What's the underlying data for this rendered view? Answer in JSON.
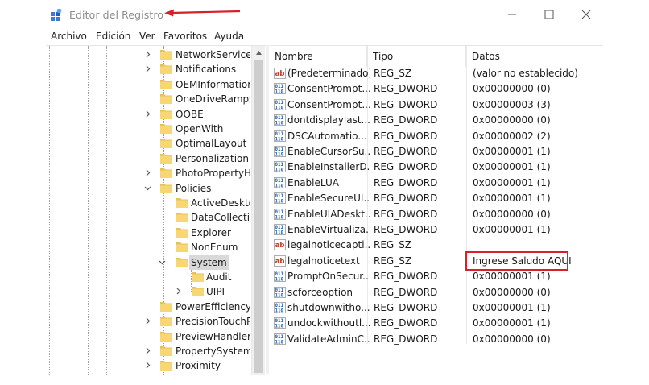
{
  "window": {
    "title": "Editor del Registro",
    "accent_color": "#d8202a"
  },
  "menu": [
    "Archivo",
    "Edición",
    "Ver",
    "Favoritos",
    "Ayuda"
  ],
  "tree": {
    "nodes": [
      {
        "label": "NetworkServiceTri",
        "level": 0,
        "expander": "collapsed"
      },
      {
        "label": "Notifications",
        "level": 0,
        "expander": "collapsed"
      },
      {
        "label": "OEMInformation",
        "level": 0,
        "expander": "none"
      },
      {
        "label": "OneDriveRamps",
        "level": 0,
        "expander": "none"
      },
      {
        "label": "OOBE",
        "level": 0,
        "expander": "collapsed"
      },
      {
        "label": "OpenWith",
        "level": 0,
        "expander": "none"
      },
      {
        "label": "OptimalLayout",
        "level": 0,
        "expander": "none"
      },
      {
        "label": "Personalization",
        "level": 0,
        "expander": "none"
      },
      {
        "label": "PhotoPropertyHa",
        "level": 0,
        "expander": "collapsed"
      },
      {
        "label": "Policies",
        "level": 0,
        "expander": "expanded"
      },
      {
        "label": "ActiveDesktop",
        "level": 1,
        "expander": "none"
      },
      {
        "label": "DataCollection",
        "level": 1,
        "expander": "none"
      },
      {
        "label": "Explorer",
        "level": 1,
        "expander": "none"
      },
      {
        "label": "NonEnum",
        "level": 1,
        "expander": "none"
      },
      {
        "label": "System",
        "level": 1,
        "expander": "expanded",
        "selected": true
      },
      {
        "label": "Audit",
        "level": 2,
        "expander": "none"
      },
      {
        "label": "UIPI",
        "level": 2,
        "expander": "collapsed"
      },
      {
        "label": "PowerEfficiencyD",
        "level": 0,
        "expander": "none"
      },
      {
        "label": "PrecisionTouchPa",
        "level": 0,
        "expander": "collapsed"
      },
      {
        "label": "PreviewHandlers",
        "level": 0,
        "expander": "none"
      },
      {
        "label": "PropertySystem",
        "level": 0,
        "expander": "collapsed"
      },
      {
        "label": "Proximity",
        "level": 0,
        "expander": "collapsed"
      }
    ]
  },
  "list": {
    "columns": [
      "Nombre",
      "Tipo",
      "Datos"
    ],
    "rows": [
      {
        "icon": "string-value-icon",
        "name": "(Predeterminado)",
        "type": "REG_SZ",
        "data": "(valor no establecido)"
      },
      {
        "icon": "binary-value-icon",
        "name": "ConsentPrompt...",
        "type": "REG_DWORD",
        "data": "0x00000000 (0)"
      },
      {
        "icon": "binary-value-icon",
        "name": "ConsentPrompt...",
        "type": "REG_DWORD",
        "data": "0x00000003 (3)"
      },
      {
        "icon": "binary-value-icon",
        "name": "dontdisplaylast...",
        "type": "REG_DWORD",
        "data": "0x00000000 (0)"
      },
      {
        "icon": "binary-value-icon",
        "name": "DSCAutomatio...",
        "type": "REG_DWORD",
        "data": "0x00000002 (2)"
      },
      {
        "icon": "binary-value-icon",
        "name": "EnableCursorSu...",
        "type": "REG_DWORD",
        "data": "0x00000001 (1)"
      },
      {
        "icon": "binary-value-icon",
        "name": "EnableInstallerD...",
        "type": "REG_DWORD",
        "data": "0x00000001 (1)"
      },
      {
        "icon": "binary-value-icon",
        "name": "EnableLUA",
        "type": "REG_DWORD",
        "data": "0x00000001 (1)"
      },
      {
        "icon": "binary-value-icon",
        "name": "EnableSecureUI...",
        "type": "REG_DWORD",
        "data": "0x00000001 (1)"
      },
      {
        "icon": "binary-value-icon",
        "name": "EnableUIADeskt...",
        "type": "REG_DWORD",
        "data": "0x00000000 (0)"
      },
      {
        "icon": "binary-value-icon",
        "name": "EnableVirtualiza...",
        "type": "REG_DWORD",
        "data": "0x00000001 (1)"
      },
      {
        "icon": "string-value-icon",
        "name": "legalnoticecapti...",
        "type": "REG_SZ",
        "data": ""
      },
      {
        "icon": "string-value-icon",
        "name": "legalnoticetext",
        "type": "REG_SZ",
        "data": "Ingrese Saludo AQUI",
        "highlighted": true
      },
      {
        "icon": "binary-value-icon",
        "name": "PromptOnSecur...",
        "type": "REG_DWORD",
        "data": "0x00000001 (1)"
      },
      {
        "icon": "binary-value-icon",
        "name": "scforceoption",
        "type": "REG_DWORD",
        "data": "0x00000000 (0)"
      },
      {
        "icon": "binary-value-icon",
        "name": "shutdownwitho...",
        "type": "REG_DWORD",
        "data": "0x00000001 (1)"
      },
      {
        "icon": "binary-value-icon",
        "name": "undockwithoutl...",
        "type": "REG_DWORD",
        "data": "0x00000001 (1)"
      },
      {
        "icon": "binary-value-icon",
        "name": "ValidateAdminC...",
        "type": "REG_DWORD",
        "data": "0x00000000 (0)"
      }
    ]
  }
}
